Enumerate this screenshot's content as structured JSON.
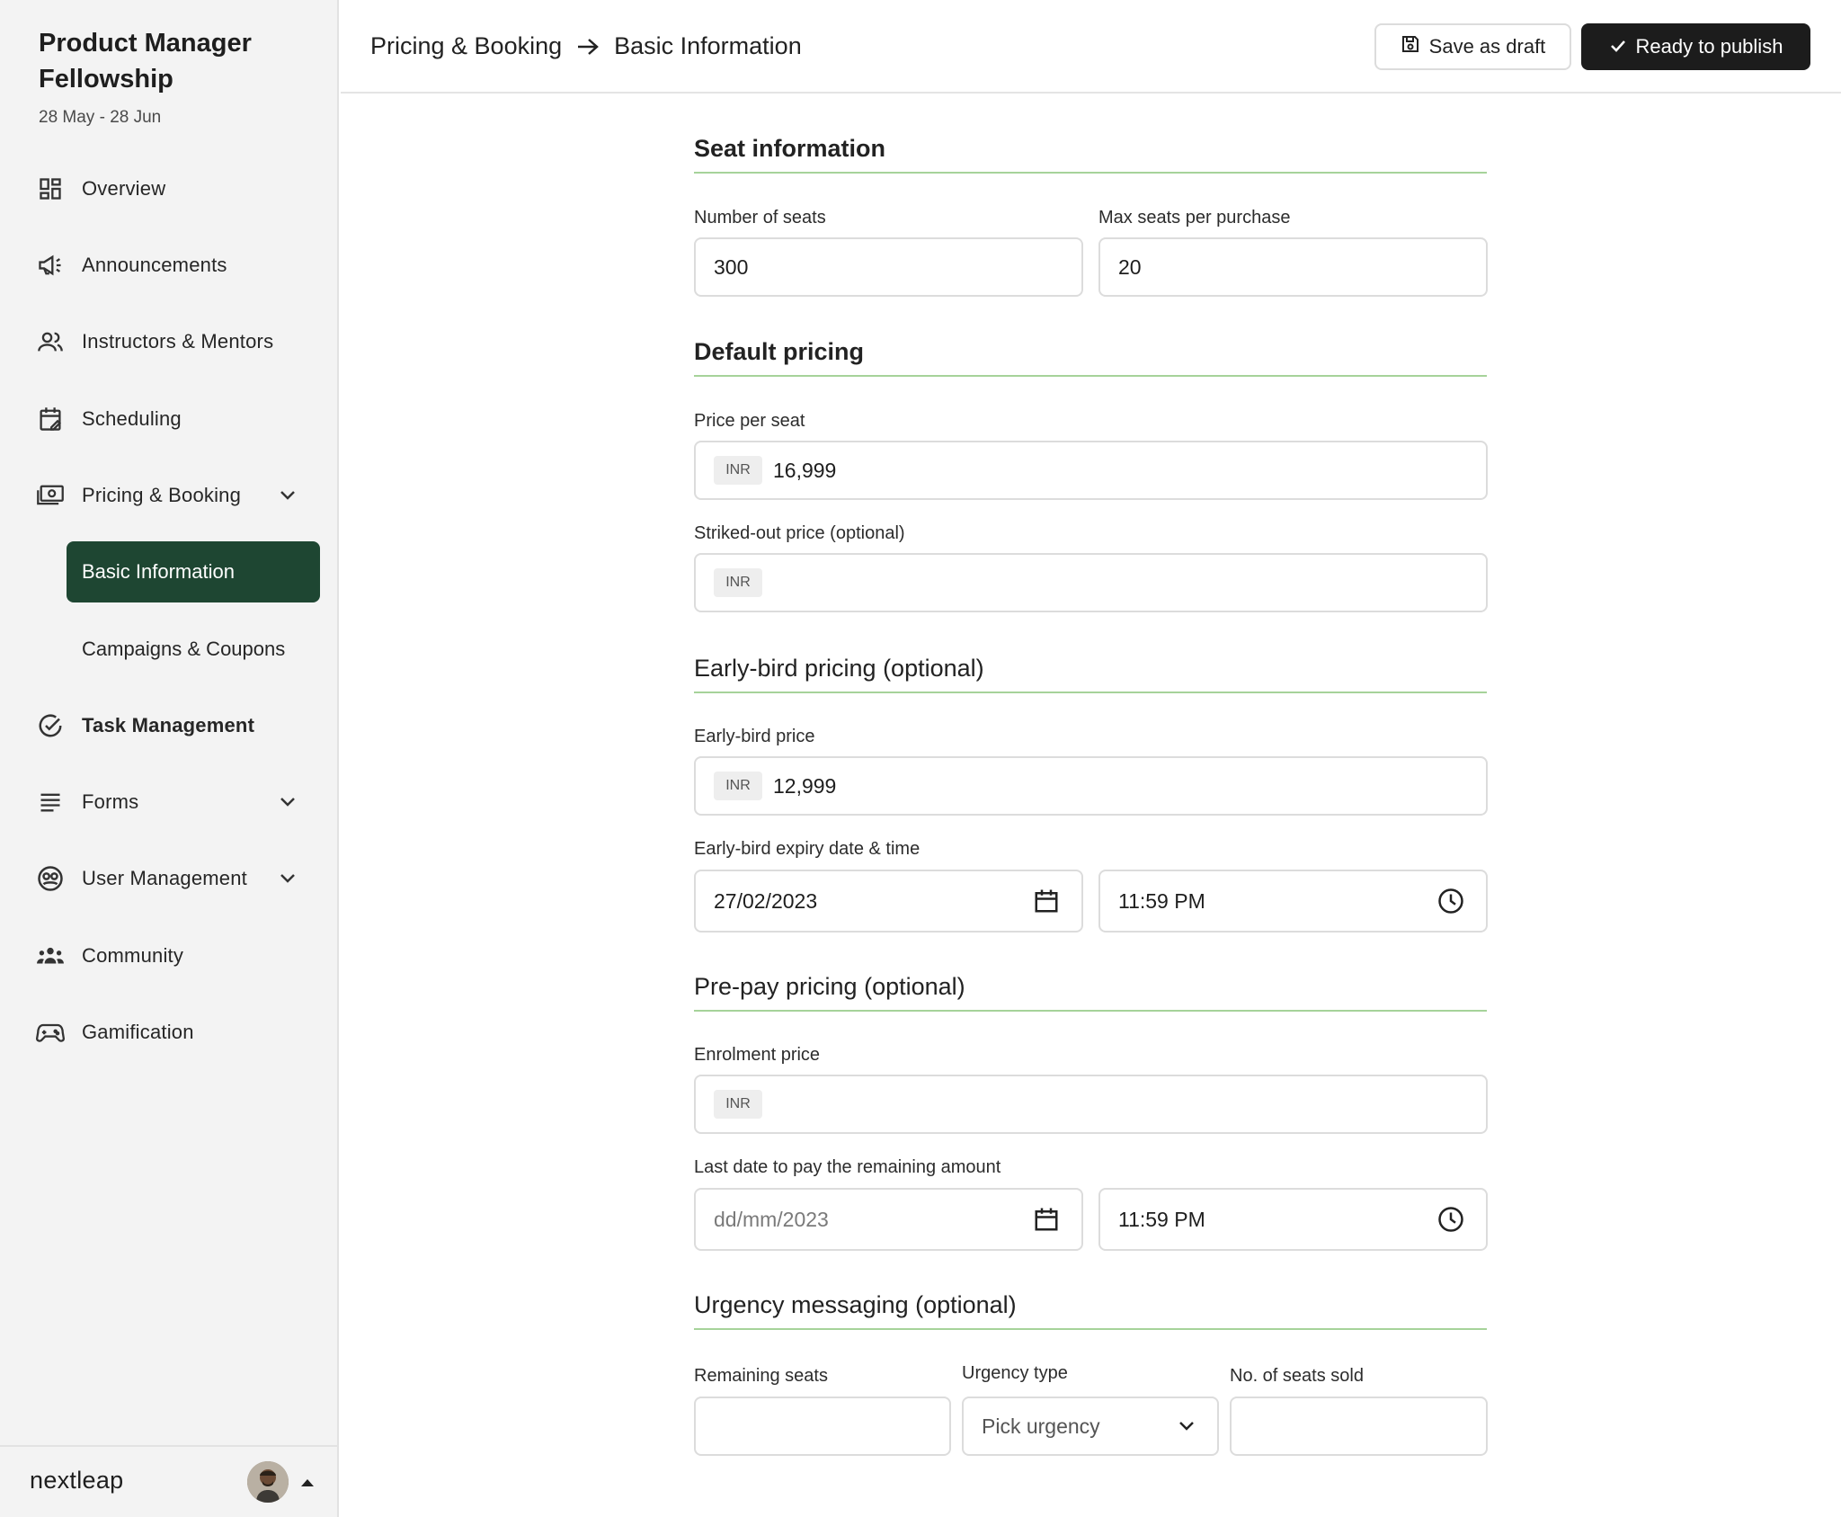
{
  "app": {
    "course_title": "Product Manager Fellowship",
    "course_dates": "28 May - 28 Jun",
    "logo_text": "nextleap"
  },
  "sidebar": {
    "items": [
      {
        "label": "Overview",
        "icon": "dashboard-icon"
      },
      {
        "label": "Announcements",
        "icon": "megaphone-icon"
      },
      {
        "label": "Instructors & Mentors",
        "icon": "users-icon"
      },
      {
        "label": "Scheduling",
        "icon": "calendar-edit-icon"
      },
      {
        "label": "Pricing & Booking",
        "icon": "money-icon",
        "expanded": true,
        "children": [
          {
            "label": "Basic Information",
            "active": true
          },
          {
            "label": "Campaigns & Coupons"
          }
        ]
      },
      {
        "label": "Task Management",
        "icon": "check-circle-icon"
      },
      {
        "label": "Forms",
        "icon": "list-icon"
      },
      {
        "label": "User Management",
        "icon": "user-circle-icon"
      },
      {
        "label": "Community",
        "icon": "community-icon"
      },
      {
        "label": "Gamification",
        "icon": "gamepad-icon"
      }
    ]
  },
  "header": {
    "breadcrumb": [
      "Pricing & Booking",
      "Basic Information"
    ],
    "save_draft_label": "Save as draft",
    "publish_label": "Ready to publish"
  },
  "form": {
    "seat": {
      "title": "Seat information",
      "num_seats_label": "Number of seats",
      "num_seats_value": "300",
      "max_seats_label": "Max seats per purchase",
      "max_seats_value": "20"
    },
    "default_pricing": {
      "title": "Default pricing",
      "price_label": "Price per seat",
      "currency": "INR",
      "price_value": "16,999",
      "striked_label": "Striked-out price (optional)",
      "striked_value": ""
    },
    "early_bird": {
      "title": "Early-bird pricing (optional)",
      "price_label": "Early-bird price",
      "price_value": "12,999",
      "expiry_label": "Early-bird expiry date & time",
      "date_value": "27/02/2023",
      "time_value": "11:59 PM"
    },
    "prepay": {
      "title": "Pre-pay pricing (optional)",
      "enrol_label": "Enrolment price",
      "enrol_value": "",
      "last_date_label": "Last date to pay the remaining amount",
      "date_placeholder": "dd/mm/2023",
      "time_value": "11:59 PM"
    },
    "urgency": {
      "title": "Urgency messaging (optional)",
      "remaining_label": "Remaining seats",
      "type_label": "Urgency type",
      "type_placeholder": "Pick urgency",
      "sold_label": "No. of seats sold"
    }
  },
  "colors": {
    "active_nav_bg": "#1e4632",
    "publish_bg": "#1c1c1c",
    "section_rule": "#a6d39a",
    "sidebar_bg": "#f3f3f3"
  }
}
